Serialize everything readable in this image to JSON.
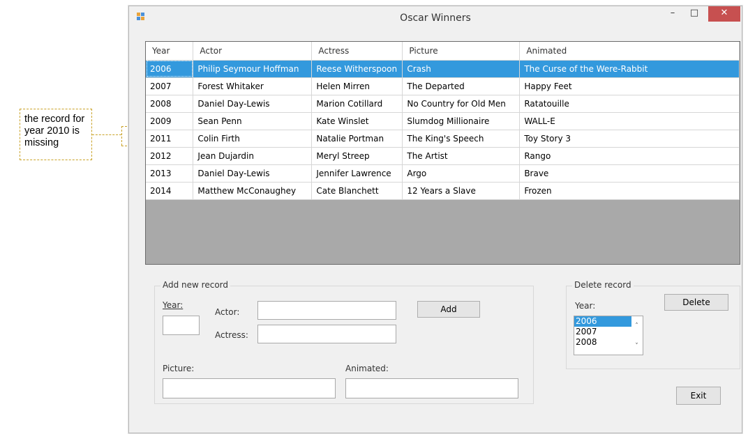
{
  "callout": {
    "text": "the record for year 2010 is missing"
  },
  "window": {
    "title": "Oscar Winners",
    "close_glyph": "✕",
    "min_glyph": "–",
    "max_glyph": "□"
  },
  "grid": {
    "columns": [
      "Year",
      "Actor",
      "Actress",
      "Picture",
      "Animated"
    ],
    "rows": [
      [
        "2006",
        "Philip Seymour Hoffman",
        "Reese Witherspoon",
        "Crash",
        "The Curse of the Were-Rabbit"
      ],
      [
        "2007",
        "Forest Whitaker",
        "Helen Mirren",
        "The Departed",
        "Happy Feet"
      ],
      [
        "2008",
        "Daniel Day-Lewis",
        "Marion Cotillard",
        "No Country for Old Men",
        "Ratatouille"
      ],
      [
        "2009",
        "Sean Penn",
        "Kate Winslet",
        "Slumdog Millionaire",
        "WALL-E"
      ],
      [
        "2011",
        "Colin Firth",
        "Natalie Portman",
        "The King's Speech",
        "Toy Story 3"
      ],
      [
        "2012",
        "Jean Dujardin",
        "Meryl Streep",
        "The Artist",
        "Rango"
      ],
      [
        "2013",
        "Daniel Day-Lewis",
        "Jennifer Lawrence",
        "Argo",
        "Brave"
      ],
      [
        "2014",
        "Matthew McConaughey",
        "Cate Blanchett",
        "12 Years a Slave",
        "Frozen"
      ]
    ],
    "selected_row": 0
  },
  "add_group": {
    "title": "Add new record",
    "year_label": "Year:",
    "actor_label": "Actor:",
    "actress_label": "Actress:",
    "picture_label": "Picture:",
    "animated_label": "Animated:",
    "add_button": "Add",
    "year_value": "",
    "actor_value": "",
    "actress_value": "",
    "picture_value": "",
    "animated_value": ""
  },
  "delete_group": {
    "title": "Delete record",
    "year_label": "Year:",
    "delete_button": "Delete",
    "years": [
      "2006",
      "2007",
      "2008"
    ],
    "selected": "2006"
  },
  "exit_button": "Exit"
}
